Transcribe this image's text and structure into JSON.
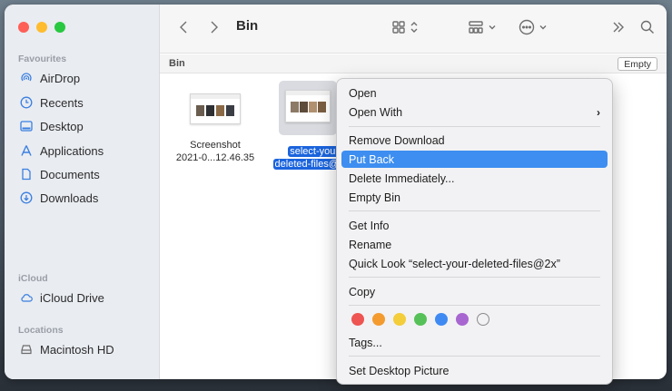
{
  "window": {
    "title": "Bin"
  },
  "sidebar": {
    "favourites_label": "Favourites",
    "favourites": [
      {
        "label": "AirDrop",
        "icon": "airdrop-icon"
      },
      {
        "label": "Recents",
        "icon": "clock-icon"
      },
      {
        "label": "Desktop",
        "icon": "desktop-icon"
      },
      {
        "label": "Applications",
        "icon": "applications-icon"
      },
      {
        "label": "Documents",
        "icon": "document-icon"
      },
      {
        "label": "Downloads",
        "icon": "download-icon"
      }
    ],
    "icloud_label": "iCloud",
    "icloud": [
      {
        "label": "iCloud Drive",
        "icon": "cloud-icon"
      }
    ],
    "locations_label": "Locations",
    "locations": [
      {
        "label": "Macintosh HD",
        "icon": "disk-icon"
      }
    ]
  },
  "pathbar": {
    "label": "Bin",
    "empty_button": "Empty"
  },
  "files": [
    {
      "line1": "Screenshot",
      "line2": "2021-0...12.46.35",
      "selected": false
    },
    {
      "line1": "select-your",
      "line2": "deleted-files@",
      "selected": true
    }
  ],
  "context_menu": {
    "items": [
      {
        "label": "Open"
      },
      {
        "label": "Open With",
        "submenu": true
      },
      {
        "label": "Remove Download"
      },
      {
        "label": "Put Back",
        "highlighted": true
      },
      {
        "label": "Delete Immediately..."
      },
      {
        "label": "Empty Bin"
      },
      {
        "label": "Get Info"
      },
      {
        "label": "Rename"
      },
      {
        "label": "Quick Look “select-your-deleted-files@2x”"
      },
      {
        "label": "Copy"
      },
      {
        "label": "Tags..."
      },
      {
        "label": "Set Desktop Picture"
      }
    ],
    "tag_colors": [
      "#ee5451",
      "#f39b2f",
      "#f3cd3a",
      "#56c158",
      "#3f8af2",
      "#a866d0",
      "none"
    ]
  },
  "colors": {
    "accent": "#3d8ef0",
    "selection": "#1b64dd"
  }
}
